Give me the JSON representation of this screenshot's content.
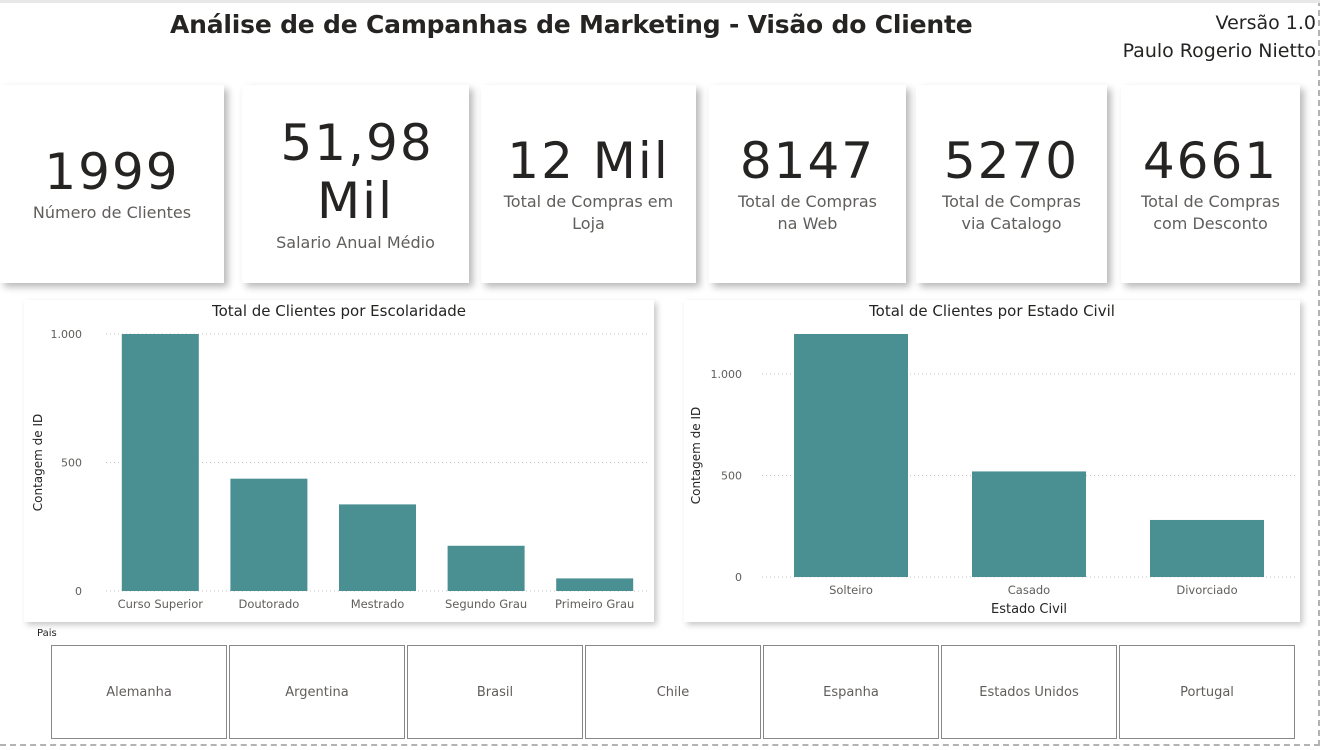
{
  "header": {
    "title": "Análise de de Campanhas de Marketing - Visão do Cliente",
    "version": "Versão 1.0",
    "author": "Paulo Rogerio Nietto"
  },
  "kpis": [
    {
      "value": "1999",
      "label": "Número de Clientes"
    },
    {
      "value": "51,98 Mil",
      "label": "Salario Anual Médio"
    },
    {
      "value": "12 Mil",
      "label": "Total de Compras em Loja"
    },
    {
      "value": "8147",
      "label": "Total de Compras na Web"
    },
    {
      "value": "5270",
      "label": "Total de Compras via Catalogo"
    },
    {
      "value": "4661",
      "label": "Total de Compras com Desconto"
    }
  ],
  "chart_data": [
    {
      "type": "bar",
      "title": "Total de Clientes por Escolaridade",
      "xlabel": "",
      "ylabel": "Contagem de ID",
      "categories": [
        "Curso Superior",
        "Doutorado",
        "Mestrado",
        "Segundo Grau",
        "Primeiro Grau"
      ],
      "values": [
        1000,
        437,
        337,
        176,
        49
      ],
      "ylim": [
        0,
        1000
      ],
      "yticks": [
        0,
        500,
        1000
      ],
      "ytick_labels": [
        "0",
        "500",
        "1.000"
      ],
      "grid": true,
      "color": "#4a9093"
    },
    {
      "type": "bar",
      "title": "Total de Clientes por Estado Civil",
      "xlabel": "Estado Civil",
      "ylabel": "Contagem de ID",
      "categories": [
        "Solteiro",
        "Casado",
        "Divorciado"
      ],
      "values": [
        1197,
        520,
        281
      ],
      "ylim": [
        0,
        1197
      ],
      "yticks": [
        0,
        500,
        1000
      ],
      "ytick_labels": [
        "0",
        "500",
        "1.000"
      ],
      "grid": true,
      "color": "#4a9093"
    }
  ],
  "slicer": {
    "label": "Pais",
    "options": [
      "Alemanha",
      "Argentina",
      "Brasil",
      "Chile",
      "Espanha",
      "Estados Unidos",
      "Portugal"
    ]
  }
}
